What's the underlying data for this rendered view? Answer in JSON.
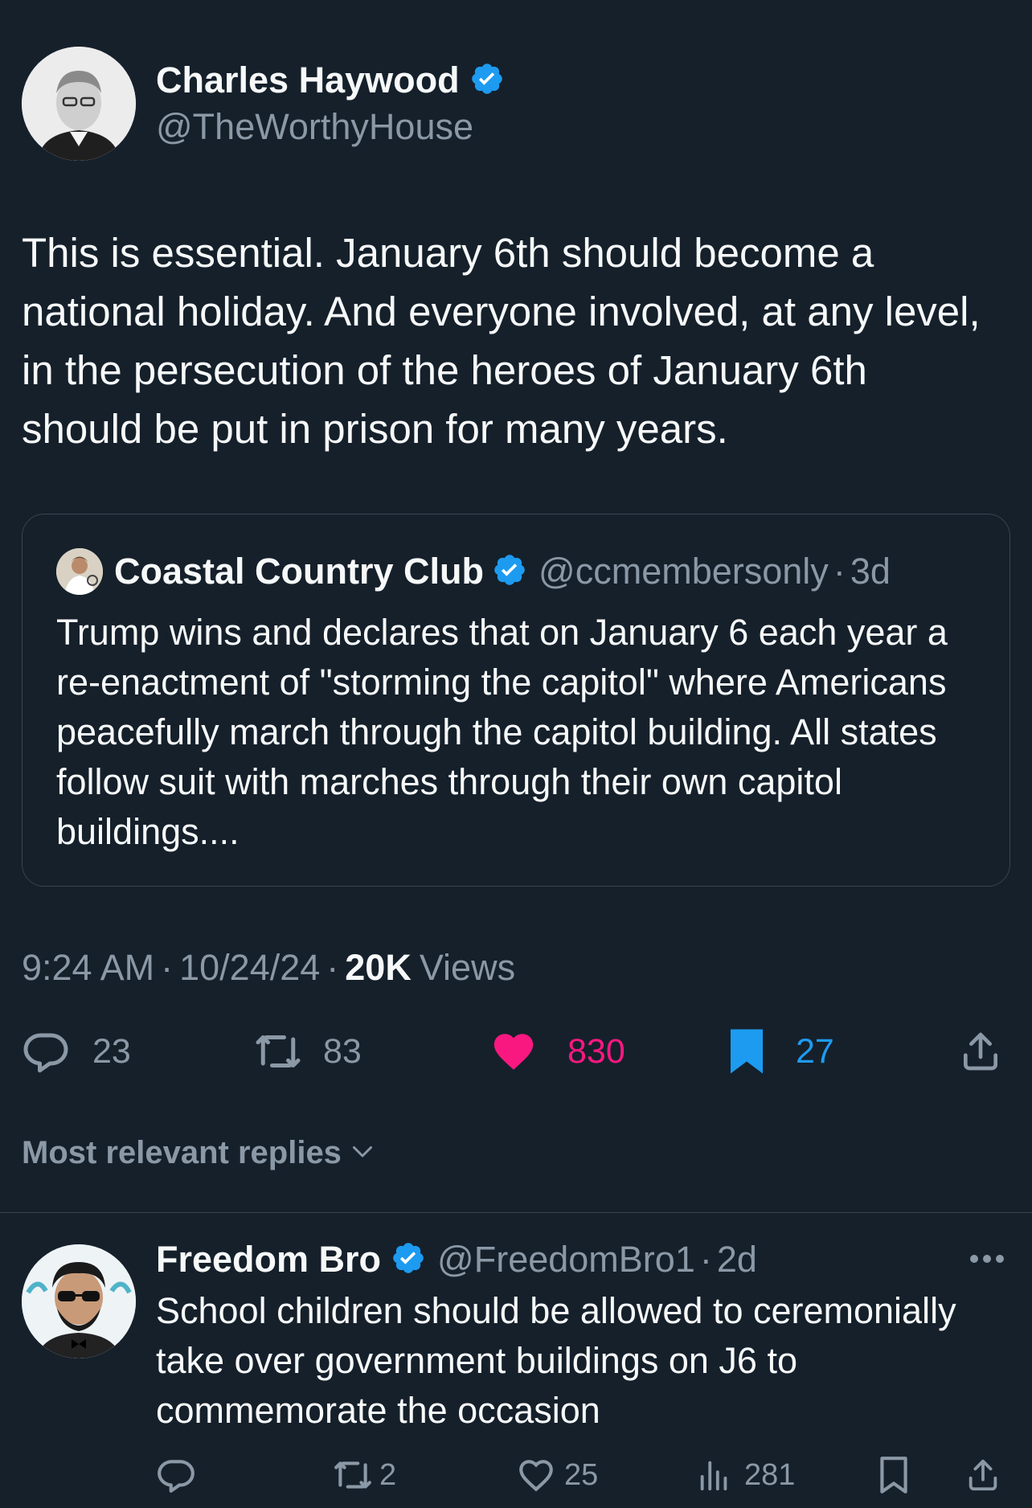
{
  "tweet": {
    "author_name": "Charles Haywood",
    "author_handle": "@TheWorthyHouse",
    "text": "This is essential.  January 6th should become a national holiday.  And everyone involved, at any level, in the persecution of the heroes of January 6th should be put in prison for many years.",
    "time": "9:24 AM",
    "date": "10/24/24",
    "views_count": "20K",
    "views_label": "Views",
    "replies": "23",
    "reposts": "83",
    "likes": "830",
    "bookmarks": "27"
  },
  "quoted": {
    "author_name": "Coastal Country Club",
    "author_handle": "@ccmembersonly",
    "age": "3d",
    "text": "Trump wins and declares that on January 6 each year a re-enactment of \"storming the capitol\" where Americans peacefully march through the capitol building.  All states follow suit with marches through their own capitol buildings...."
  },
  "replies_header": {
    "label": "Most relevant replies"
  },
  "reply": {
    "author_name": "Freedom Bro",
    "author_handle": "@FreedomBro1",
    "age": "2d",
    "text": "School children should be allowed to ceremonially take over government buildings on J6 to commemorate the occasion",
    "reposts": "2",
    "likes": "25",
    "views": "281"
  },
  "separator": "·",
  "colors": {
    "background": "#15202b",
    "secondary_text": "#8b98a5",
    "verified_blue": "#1d9bf0",
    "like_pink": "#f91880",
    "border": "#38444d"
  },
  "icons": [
    "verified-badge-icon",
    "reply-icon",
    "repost-icon",
    "like-icon",
    "bookmark-icon",
    "share-icon",
    "chevron-down-icon",
    "views-icon",
    "more-icon"
  ]
}
